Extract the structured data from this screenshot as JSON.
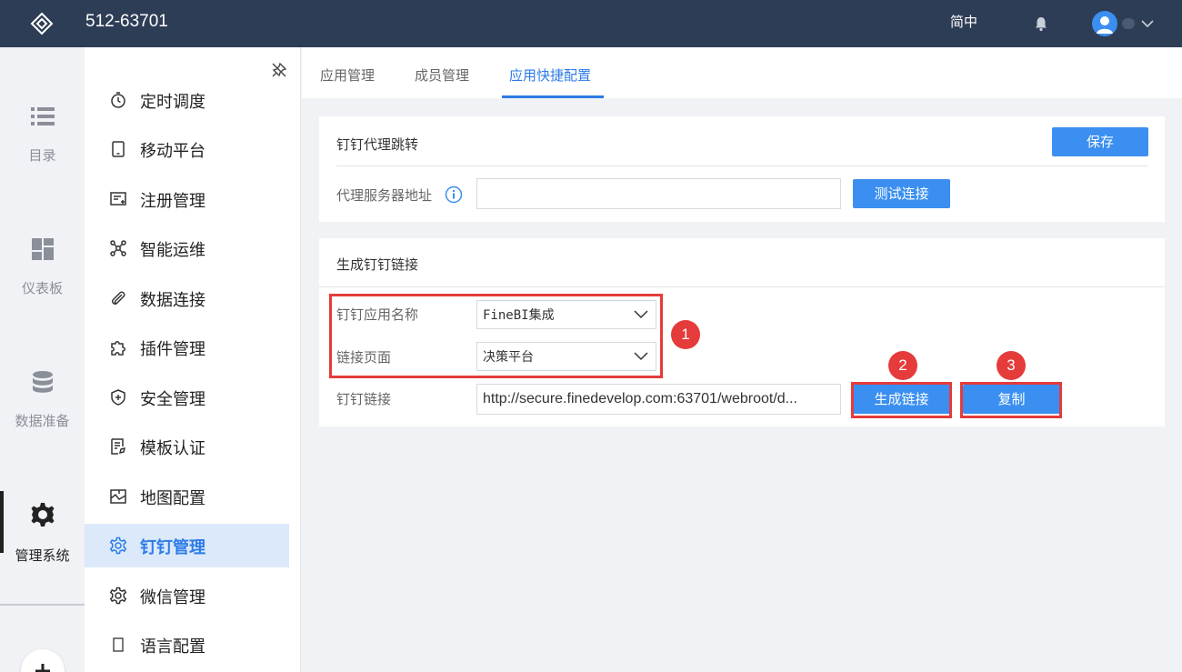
{
  "header": {
    "title": "512-63701",
    "language": "简中",
    "icons": {
      "logo": "diamond-logo-icon",
      "bell": "bell-icon",
      "avatar": "user-avatar-icon",
      "chevron": "chevron-down-icon"
    }
  },
  "rail": {
    "items": [
      {
        "label": "目录",
        "icon": "list-icon"
      },
      {
        "label": "仪表板",
        "icon": "dashboard-icon"
      },
      {
        "label": "数据准备",
        "icon": "database-icon"
      },
      {
        "label": "管理系统",
        "icon": "gear-icon",
        "active": true
      }
    ],
    "add_icon": "plus-icon"
  },
  "submenu": {
    "items": [
      {
        "label": "定时调度",
        "icon": "timer-icon"
      },
      {
        "label": "移动平台",
        "icon": "tablet-icon"
      },
      {
        "label": "注册管理",
        "icon": "register-icon"
      },
      {
        "label": "智能运维",
        "icon": "network-icon"
      },
      {
        "label": "数据连接",
        "icon": "paperclip-icon"
      },
      {
        "label": "插件管理",
        "icon": "puzzle-icon"
      },
      {
        "label": "安全管理",
        "icon": "shield-icon"
      },
      {
        "label": "模板认证",
        "icon": "document-icon"
      },
      {
        "label": "地图配置",
        "icon": "map-icon"
      },
      {
        "label": "钉钉管理",
        "icon": "gear-icon",
        "active": true
      },
      {
        "label": "微信管理",
        "icon": "gear-icon"
      },
      {
        "label": "语言配置",
        "icon": "language-icon"
      }
    ]
  },
  "tabs": [
    {
      "label": "应用管理"
    },
    {
      "label": "成员管理"
    },
    {
      "label": "应用快捷配置",
      "active": true
    }
  ],
  "proxy_card": {
    "title": "钉钉代理跳转",
    "save_label": "保存",
    "server_label": "代理服务器地址",
    "server_value": "",
    "test_label": "测试连接"
  },
  "link_card": {
    "title": "生成钉钉链接",
    "app_name_label": "钉钉应用名称",
    "app_name_value": "FineBI集成",
    "page_label": "链接页面",
    "page_value": "决策平台",
    "link_label": "钉钉链接",
    "link_value": "http://secure.finedevelop.com:63701/webroot/d...",
    "generate_label": "生成链接",
    "copy_label": "复制"
  },
  "annotations": {
    "badge1": "1",
    "badge2": "2",
    "badge3": "3"
  },
  "colors": {
    "header_bg": "#2e3d56",
    "accent": "#3a8ff0",
    "highlight": "#e53b3b",
    "active_menu_bg": "#dbe9fb"
  }
}
